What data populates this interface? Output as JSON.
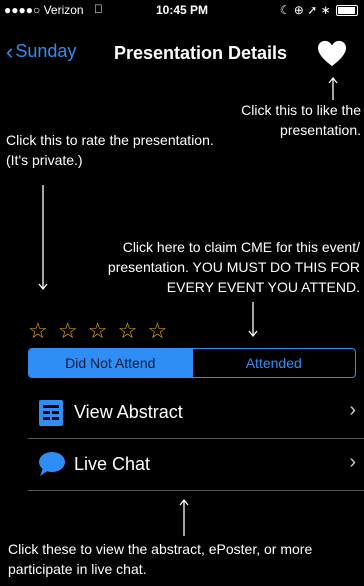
{
  "status": {
    "carrier": "●●●●○ Verizon",
    "time": "10:45 PM",
    "right_icons": "☾ ⊕ ➚ ∗"
  },
  "nav": {
    "back_label": "Sunday",
    "title": "Presentation Details"
  },
  "notes": {
    "like": "Click this to like the presentation.",
    "rate": "Click this to rate the presentation. (It's private.)",
    "cme": "Click here to claim CME for this event/ presentation. YOU MUST DO THIS FOR EVERY EVENT YOU ATTEND.",
    "bottom": "Click these to view the abstract, ePoster, or more participate in live chat."
  },
  "rating": {
    "stars": [
      "☆",
      "☆",
      "☆",
      "☆",
      "☆"
    ]
  },
  "attendance": {
    "options": [
      "Did Not Attend",
      "Attended"
    ],
    "selected": "Did Not Attend"
  },
  "menu": [
    {
      "icon": "document-icon",
      "label": "View Abstract"
    },
    {
      "icon": "chat-bubble-icon",
      "label": "Live Chat"
    }
  ],
  "colors": {
    "accent": "#2f8df6",
    "star": "#e6a817",
    "background": "#000000"
  }
}
